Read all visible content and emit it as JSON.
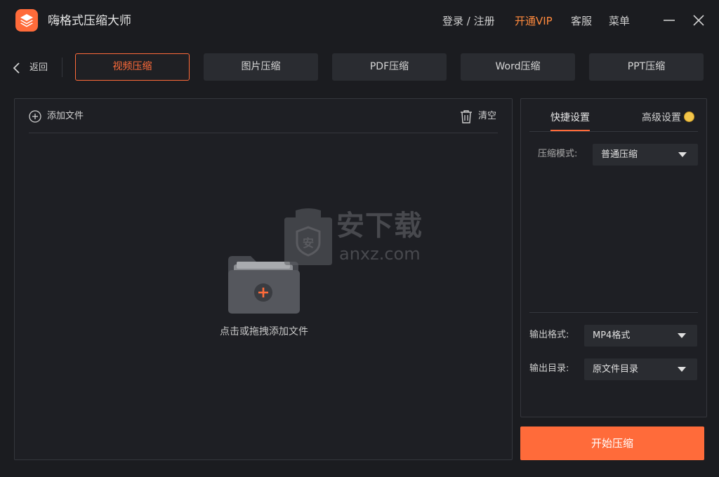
{
  "app": {
    "title": "嗨格式压缩大师"
  },
  "top_nav": {
    "login": "登录 / 注册",
    "vip": "开通VIP",
    "service": "客服",
    "menu": "菜单"
  },
  "back_label": "返回",
  "tabs": [
    {
      "label": "视频压缩",
      "active": true
    },
    {
      "label": "图片压缩",
      "active": false
    },
    {
      "label": "PDF压缩",
      "active": false
    },
    {
      "label": "Word压缩",
      "active": false
    },
    {
      "label": "PPT压缩",
      "active": false
    }
  ],
  "left": {
    "add_file": "添加文件",
    "clear": "清空",
    "drop_hint": "点击或拖拽添加文件"
  },
  "watermark": {
    "cn": "安下载",
    "en": "anxz.com",
    "shield": "安"
  },
  "right": {
    "tab_quick": "快捷设置",
    "tab_advanced": "高级设置",
    "compress_mode_label": "压缩模式:",
    "compress_mode_value": "普通压缩",
    "output_format_label": "输出格式:",
    "output_format_value": "MP4格式",
    "output_dir_label": "输出目录:",
    "output_dir_value": "原文件目录"
  },
  "start_button": "开始压缩",
  "colors": {
    "accent": "#ff6b3a",
    "vip": "#ff8a3d",
    "bg": "#1b1c20",
    "panel": "#1e1f24"
  },
  "icons": [
    "app-logo-icon",
    "minimize-icon",
    "close-icon",
    "back-chevron-icon",
    "add-circle-icon",
    "trash-icon",
    "folder-add-icon",
    "coin-icon",
    "caret-down-icon"
  ]
}
